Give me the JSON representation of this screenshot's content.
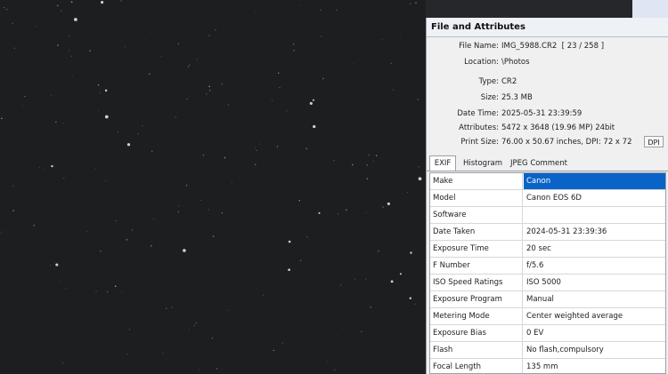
{
  "panel": {
    "title": "File and Attributes",
    "file_name_label": "File Name:",
    "file_name": "IMG_5988.CR2",
    "file_index": "[ 23 / 258 ]",
    "location_label": "Location:",
    "location": "\\Photos",
    "type_label": "Type:",
    "type": "CR2",
    "size_label": "Size:",
    "size": "25.3 MB",
    "datetime_label": "Date Time:",
    "datetime": "2025-05-31 23:39:59",
    "attributes_label": "Attributes:",
    "attributes": "5472 x 3648 (19.96 MP)  24bit",
    "print_size_label": "Print Size:",
    "print_size": "76.00 x 50.67 inches,  DPI: 72 x 72",
    "dpi_button": "DPI"
  },
  "tabs": [
    {
      "label": "EXIF",
      "active": true
    },
    {
      "label": "Histogram",
      "active": false
    },
    {
      "label": "JPEG Comment",
      "active": false
    }
  ],
  "exif": [
    {
      "key": "Make",
      "value": "Canon",
      "selected": true
    },
    {
      "key": "Model",
      "value": "Canon EOS 6D"
    },
    {
      "key": "Software",
      "value": ""
    },
    {
      "key": "Date Taken",
      "value": "2024-05-31 23:39:36"
    },
    {
      "key": "Exposure Time",
      "value": "20 sec"
    },
    {
      "key": "F Number",
      "value": "f/5.6"
    },
    {
      "key": "ISO Speed Ratings",
      "value": "ISO 5000"
    },
    {
      "key": "Exposure Program",
      "value": "Manual"
    },
    {
      "key": "Metering Mode",
      "value": "Center weighted average"
    },
    {
      "key": "Exposure Bias",
      "value": "0 EV"
    },
    {
      "key": "Flash",
      "value": "No flash,compulsory"
    },
    {
      "key": "Focal Length",
      "value": "135 mm"
    }
  ],
  "colors": {
    "sky": "#1d1e20",
    "selection": "#0a64c8",
    "panel_bg": "#f0f0f0"
  }
}
